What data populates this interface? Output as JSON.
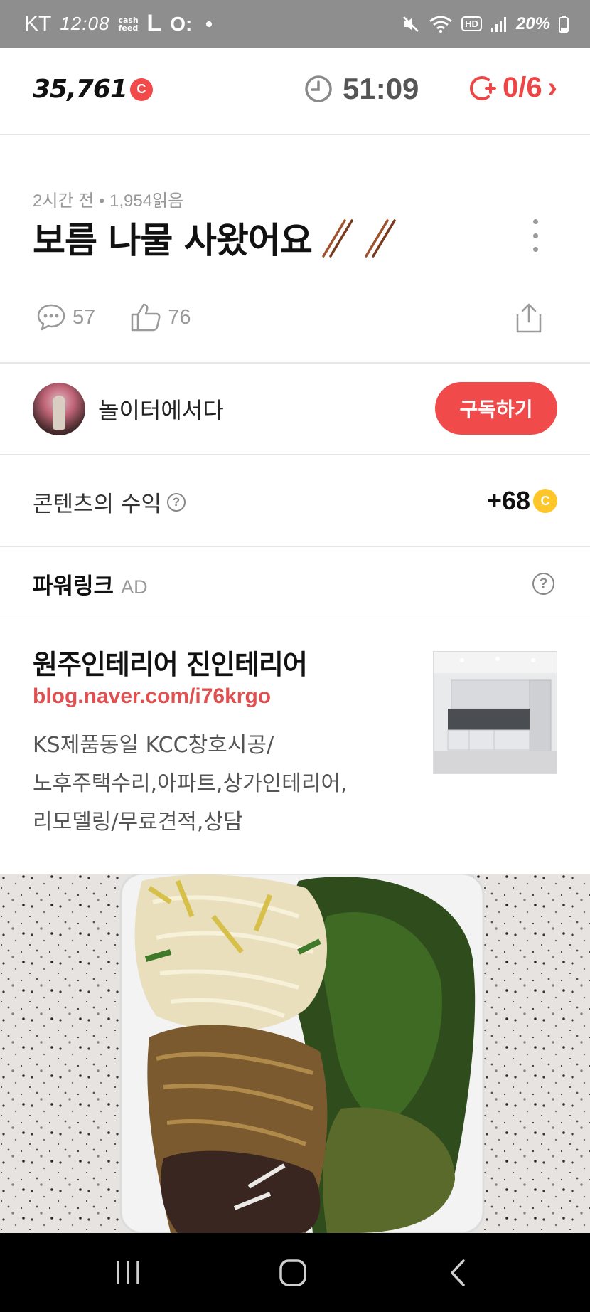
{
  "status_bar": {
    "carrier": "KT",
    "time": "12:08",
    "cash_icon_text": "cash feed",
    "app_letter": "L",
    "app_glyph": "O:",
    "hd_badge": "HD",
    "battery": "20%"
  },
  "header": {
    "points": "35,761",
    "points_coin": "C",
    "timer": "51:09",
    "counter": "0/6",
    "counter_chevron": "›"
  },
  "article": {
    "meta": "2시간 전 • 1,954읽음",
    "title": "보름 나물 사왔어요",
    "comment_count": "57",
    "like_count": "76"
  },
  "author": {
    "name": "놀이터에서다",
    "subscribe_label": "구독하기"
  },
  "revenue": {
    "label": "콘텐츠의 수익",
    "help": "?",
    "value": "+68",
    "coin": "C"
  },
  "powerlink": {
    "title": "파워링크",
    "ad_tag": "AD",
    "help": "?",
    "ad": {
      "title": "원주인테리어 진인테리어",
      "url": "blog.naver.com/i76krgo",
      "desc_lines": [
        "KS제품동일 KCC창호시공/",
        "노후주택수리,아파트,상가인테리어,",
        "리모델링/무료견적,상담"
      ]
    }
  },
  "icons": {
    "clock": "clock-icon",
    "counter": "coin-plus-icon",
    "comment": "comment-icon",
    "like": "thumbs-up-icon",
    "share": "share-icon",
    "kebab": "more-vertical-icon"
  },
  "colors": {
    "accent_red": "#f04a4a",
    "coin_yellow": "#ffc629",
    "url_red": "#e05050",
    "status_bar": "#8e8e8e"
  }
}
